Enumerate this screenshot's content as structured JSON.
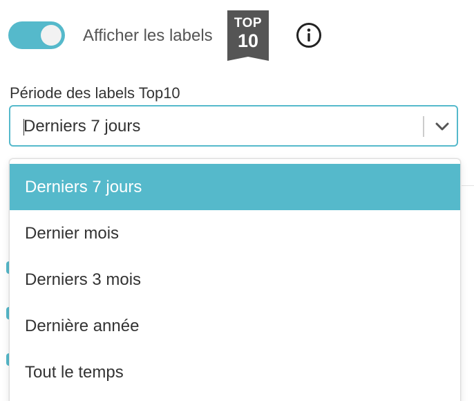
{
  "toggle": {
    "label": "Afficher les labels",
    "on": true
  },
  "badge": {
    "line1": "TOP",
    "line2": "10"
  },
  "icons": {
    "info": "info-circle-icon",
    "chevron": "chevron-down-icon"
  },
  "period": {
    "label": "Période des labels Top10",
    "selected": "Derniers 7 jours",
    "options": [
      {
        "label": "Derniers 7 jours",
        "selected": true
      },
      {
        "label": "Dernier mois",
        "selected": false
      },
      {
        "label": "Derniers 3 mois",
        "selected": false
      },
      {
        "label": "Dernière année",
        "selected": false
      },
      {
        "label": "Tout le temps",
        "selected": false
      }
    ]
  },
  "colors": {
    "accent": "#55b9cb",
    "badge_bg": "#555555",
    "text": "#333333"
  }
}
